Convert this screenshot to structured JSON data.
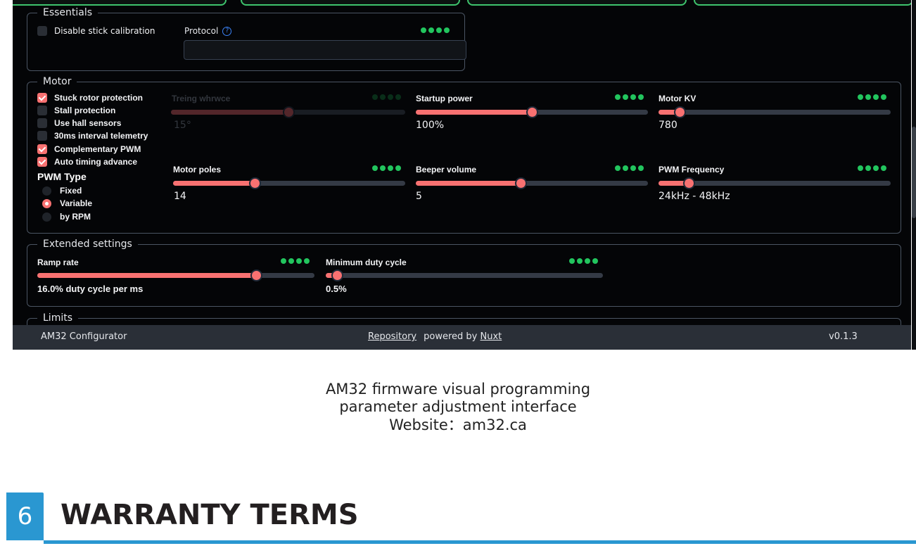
{
  "essentials": {
    "legend": "Essentials",
    "disable_stick_label": "Disable stick calibration",
    "protocol_label": "Protocol",
    "protocol_help": "?"
  },
  "motor": {
    "legend": "Motor",
    "checkboxes": [
      {
        "label": "Stuck rotor protection",
        "checked": true
      },
      {
        "label": "Stall protection",
        "checked": false
      },
      {
        "label": "Use hall sensors",
        "checked": false
      },
      {
        "label": "30ms interval telemetry",
        "checked": false
      },
      {
        "label": "Complementary PWM",
        "checked": true
      },
      {
        "label": "Auto timing advance",
        "checked": true
      }
    ],
    "pwm_type": {
      "title": "PWM Type",
      "options": [
        {
          "label": "Fixed",
          "selected": false
        },
        {
          "label": "Variable",
          "selected": true
        },
        {
          "label": "by RPM",
          "selected": false
        }
      ]
    },
    "sliders": [
      {
        "label": "Treing whrwce",
        "value": "15°",
        "level": 0.5,
        "disabled": true
      },
      {
        "label": "Startup power",
        "value": "100%",
        "level": 0.5
      },
      {
        "label": "Motor KV",
        "value": "780",
        "level": 0.09
      },
      {
        "label": "Motor poles",
        "value": "14",
        "level": 0.35
      },
      {
        "label": "Beeper volume",
        "value": "5",
        "level": 0.45
      },
      {
        "label": "PWM Frequency",
        "value": "24kHz - 48kHz",
        "level": 0.13
      }
    ]
  },
  "extended": {
    "legend": "Extended settings",
    "sliders": [
      {
        "label": "Ramp rate",
        "value": "16.0% duty cycle per ms",
        "level": 0.79
      },
      {
        "label": "Minimum duty cycle",
        "value": "0.5%",
        "level": 0.04
      }
    ]
  },
  "limits": {
    "legend": "Limits"
  },
  "footer": {
    "app_name": "AM32 Configurator",
    "repository": "Repository",
    "powered_by": "powered by",
    "nuxt": "Nuxt",
    "version": "v0.1.3"
  },
  "caption": {
    "line1": "AM32 firmware visual programming",
    "line2": "parameter adjustment interface",
    "line3": "Website：am32.ca"
  },
  "section": {
    "number": "6",
    "title": "WARRANTY TERMS"
  },
  "colors": {
    "accent_red": "#f87171",
    "indicator_green": "#22c55e",
    "section_blue": "#2a97d1"
  }
}
